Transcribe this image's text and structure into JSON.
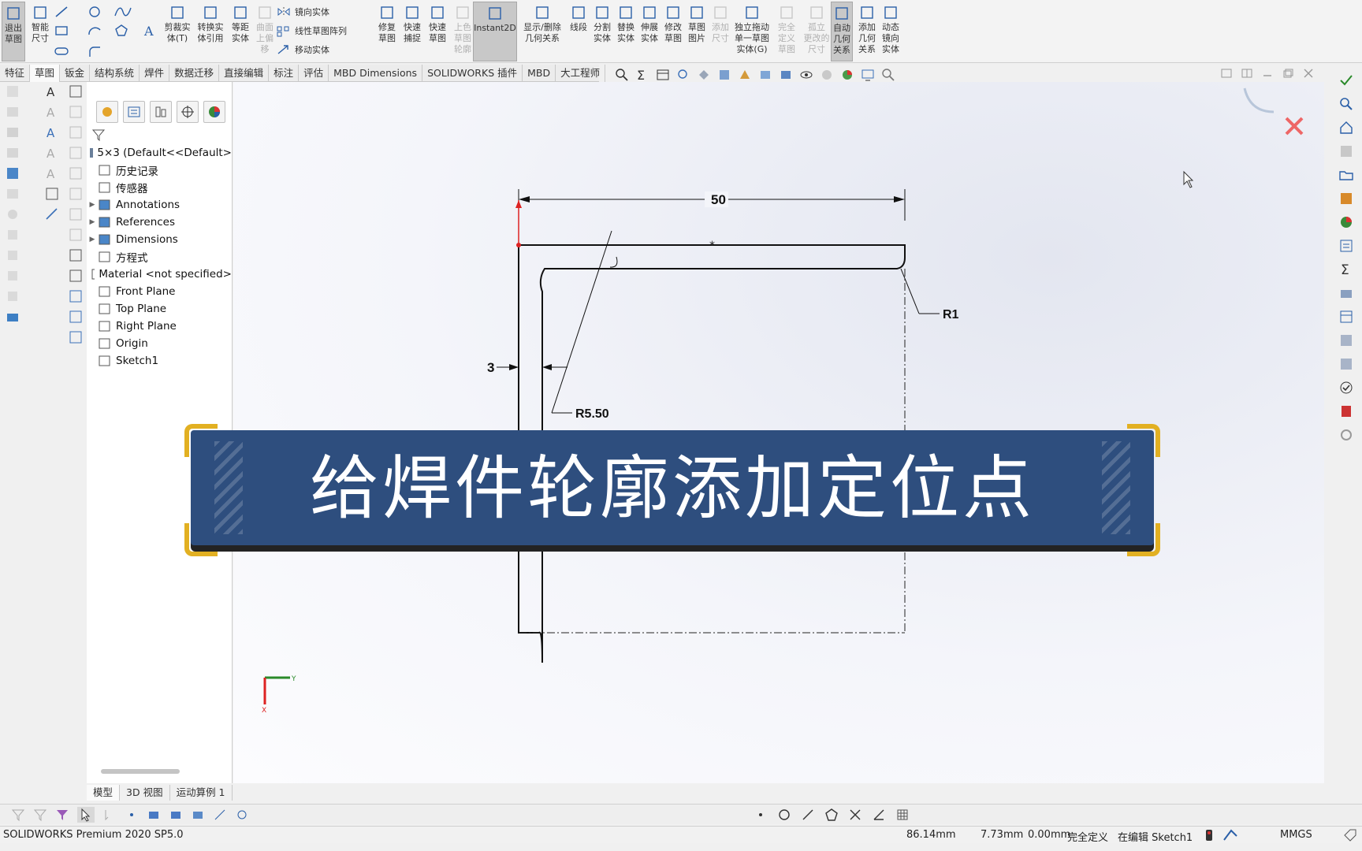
{
  "ribbon": {
    "buttons": [
      {
        "id": "exit-sketch",
        "label": "退出\n草图",
        "active": true
      },
      {
        "id": "smart-dim",
        "label": "智能\n尺寸"
      },
      {
        "id": "trim",
        "label": "剪裁实\n体(T)"
      },
      {
        "id": "convert",
        "label": "转换实\n体引用"
      },
      {
        "id": "offset",
        "label": "等距\n实体"
      },
      {
        "id": "surface-offset",
        "label": "曲面\n上偏\n移",
        "disabled": true
      },
      {
        "id": "repair",
        "label": "修复\n草图"
      },
      {
        "id": "quick-snap",
        "label": "快速\n捕捉"
      },
      {
        "id": "rapid-sketch",
        "label": "快速\n草图"
      },
      {
        "id": "shade",
        "label": "上色\n草图\n轮廓",
        "disabled": true
      },
      {
        "id": "instant2d",
        "label": "Instant2D",
        "active": true
      },
      {
        "id": "show-relations",
        "label": "显示/删除\n几何关系"
      },
      {
        "id": "segment",
        "label": "线段"
      },
      {
        "id": "split",
        "label": "分割\n实体"
      },
      {
        "id": "replace",
        "label": "替换\n实体"
      },
      {
        "id": "stretch",
        "label": "伸展\n实体"
      },
      {
        "id": "modify",
        "label": "修改\n草图"
      },
      {
        "id": "picture",
        "label": "草图\n图片"
      },
      {
        "id": "add-dim",
        "label": "添加\n尺寸",
        "disabled": true
      },
      {
        "id": "drag-single",
        "label": "独立拖动\n单一草图\n实体(G)"
      },
      {
        "id": "full-define",
        "label": "完全\n定义\n草图",
        "disabled": true
      },
      {
        "id": "isolate",
        "label": "孤立\n更改的\n尺寸",
        "disabled": true
      },
      {
        "id": "auto-relations",
        "label": "自动\n几何\n关系",
        "active": true
      },
      {
        "id": "add-relations",
        "label": "添加\n几何\n关系"
      },
      {
        "id": "dynamic-mirror",
        "label": "动态\n镜向\n实体"
      }
    ],
    "small": {
      "mirror": "镜向实体",
      "linear-pattern": "线性草图阵列",
      "move": "移动实体"
    }
  },
  "tabs": [
    "特征",
    "草图",
    "钣金",
    "结构系统",
    "焊件",
    "数据迁移",
    "直接编辑",
    "标注",
    "评估",
    "MBD Dimensions",
    "SOLIDWORKS 插件",
    "MBD",
    "大工程师"
  ],
  "active_tab": "草图",
  "tree": {
    "root": "5×3  (Default<<Default>",
    "items": [
      {
        "label": "历史记录",
        "expandable": false
      },
      {
        "label": "传感器",
        "expandable": false
      },
      {
        "label": "Annotations",
        "expandable": true
      },
      {
        "label": "References",
        "expandable": true
      },
      {
        "label": "Dimensions",
        "expandable": true
      },
      {
        "label": "方程式",
        "expandable": false
      },
      {
        "label": "Material <not specified>",
        "expandable": false
      },
      {
        "label": "Front Plane",
        "expandable": false
      },
      {
        "label": "Top Plane",
        "expandable": false
      },
      {
        "label": "Right Plane",
        "expandable": false
      },
      {
        "label": "Origin",
        "expandable": false
      },
      {
        "label": "Sketch1",
        "expandable": false
      }
    ]
  },
  "sketch": {
    "dim_width": "50",
    "dim_thickness": "3",
    "dim_inner_radius": "R5.50",
    "dim_outer_radius": "R1"
  },
  "banner": {
    "text": "给焊件轮廓添加定位点"
  },
  "bottom_tabs": [
    "模型",
    "3D 视图",
    "运动算例 1"
  ],
  "status": {
    "app": "SOLIDWORKS Premium 2020 SP5.0",
    "x": "86.14mm",
    "y": "7.73mm",
    "z": "0.00mm",
    "state": "完全定义",
    "editing": "在编辑 Sketch1",
    "units": "MMGS"
  },
  "colors": {
    "banner_bg": "#2e4e7e",
    "banner_accent": "#e2b022",
    "active_button": "#c8c8c8"
  }
}
